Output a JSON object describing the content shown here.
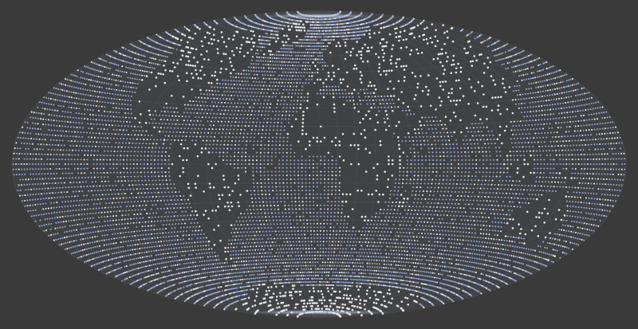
{
  "map": {
    "projection": "hammer-aitoff",
    "graticule": true,
    "graticule_step_deg": 10,
    "point_spacing_deg": 2,
    "colors": {
      "background": "#3a3a3a",
      "ocean": "#3f4144",
      "graticule": "#4c4e52",
      "land_point": "#e6e6e6",
      "ocean_point_blue": "#8fa3df",
      "ocean_point_grey": "#9a9ea6",
      "rim_glow": "#c9d6f2"
    }
  }
}
